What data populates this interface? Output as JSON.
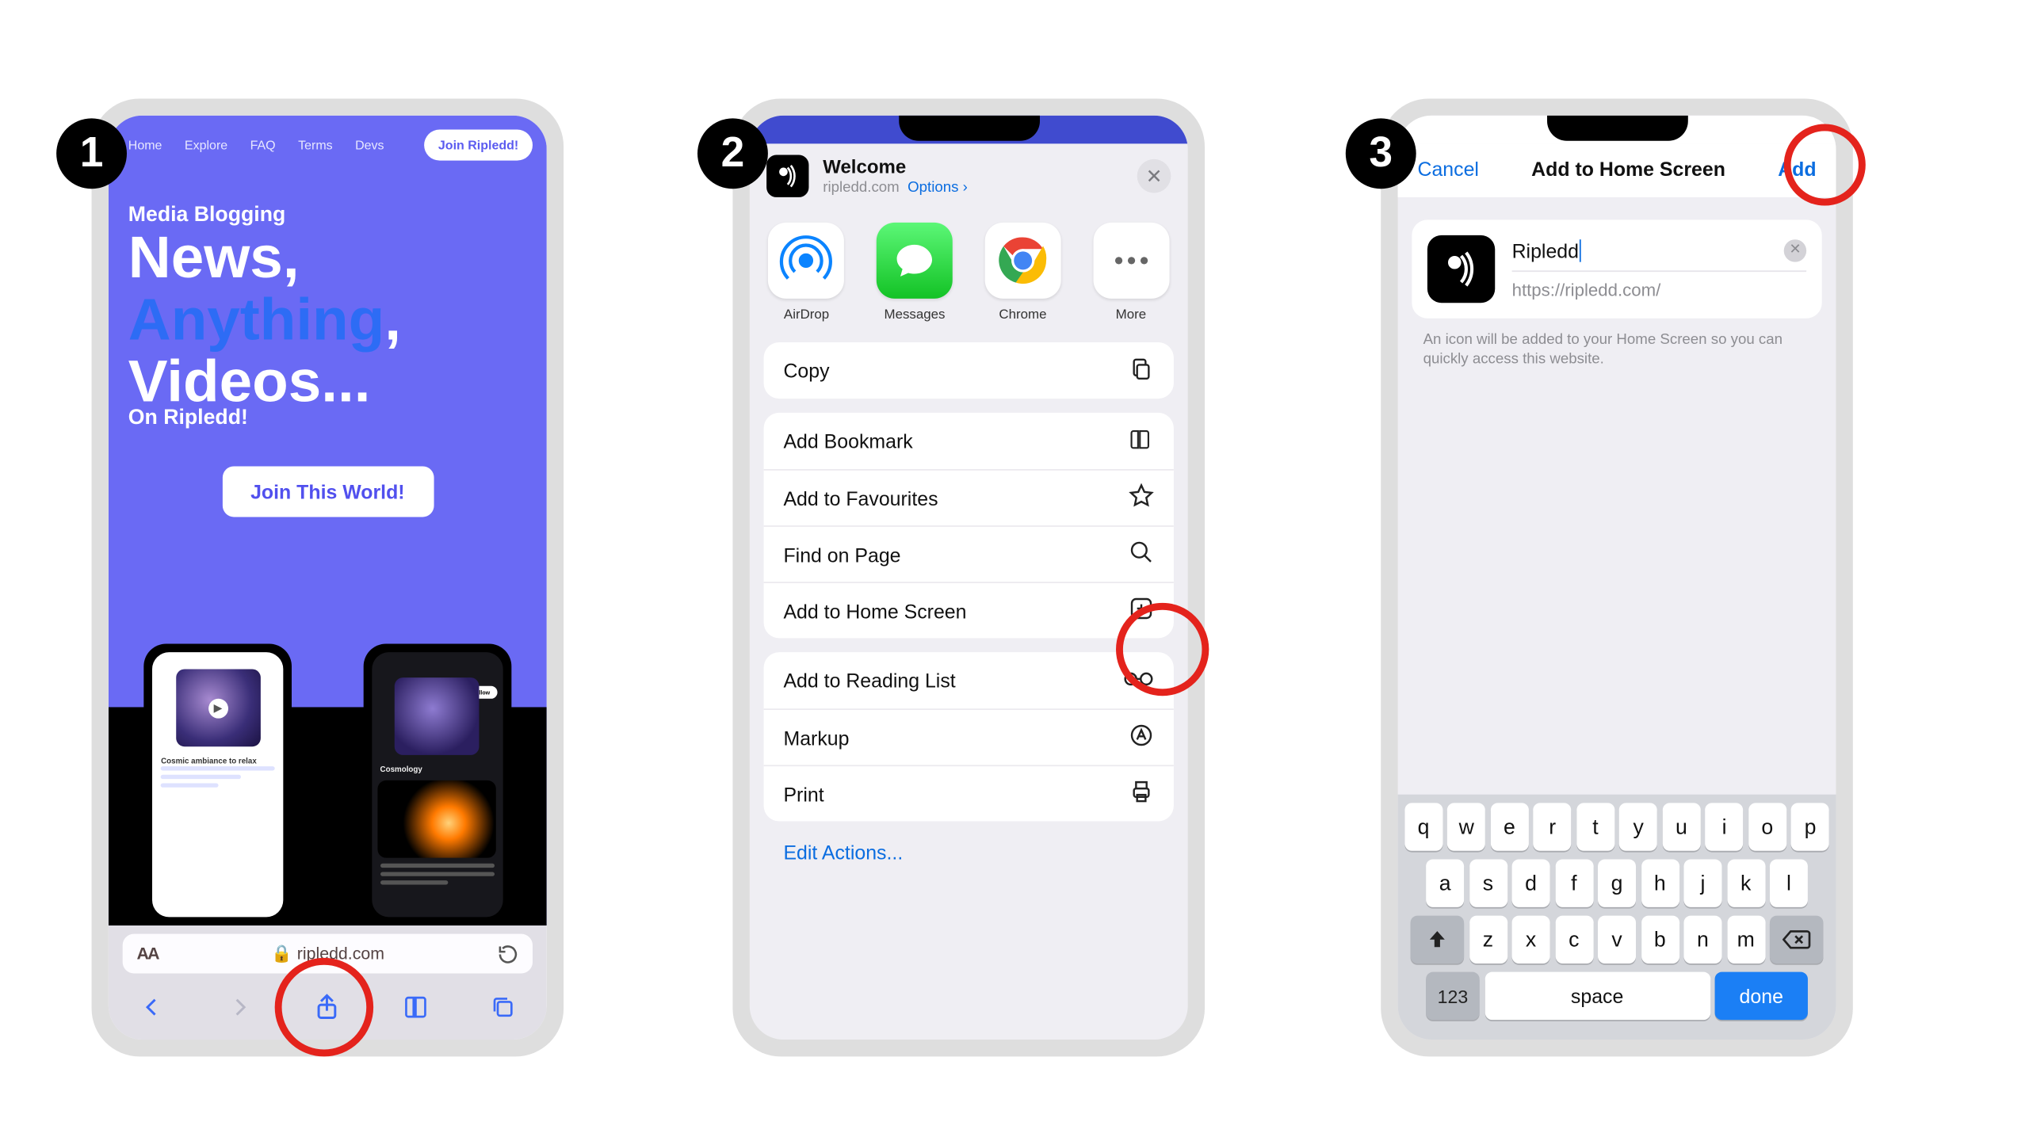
{
  "badges": [
    "1",
    "2",
    "3"
  ],
  "step1": {
    "nav": {
      "home": "Home",
      "explore": "Explore",
      "faq": "FAQ",
      "terms": "Terms",
      "devs": "Devs",
      "join": "Join Ripledd!"
    },
    "hero": {
      "tag": "Media Blogging",
      "l1": "News,",
      "l2": "Anything",
      "comma": ",",
      "l3": "Videos...",
      "sub": "On Ripledd!",
      "cta": "Join This World!"
    },
    "url": {
      "aa": "AA",
      "lock": "🔒",
      "domain": "ripledd.com"
    }
  },
  "step2": {
    "title": "Welcome",
    "site": "ripledd.com",
    "options": "Options",
    "chev": "›",
    "apps": [
      {
        "label": "AirDrop"
      },
      {
        "label": "Messages"
      },
      {
        "label": "Chrome"
      },
      {
        "label": "More"
      }
    ],
    "rows": {
      "copy": "Copy",
      "bookmark": "Add Bookmark",
      "fav": "Add to Favourites",
      "find": "Find on Page",
      "home": "Add to Home Screen",
      "read": "Add to Reading List",
      "markup": "Markup",
      "print": "Print"
    },
    "edit": "Edit Actions..."
  },
  "step3": {
    "cancel": "Cancel",
    "title": "Add to Home Screen",
    "add": "Add",
    "name": "Ripledd",
    "url": "https://ripledd.com/",
    "note": "An icon will be added to your Home Screen so you can quickly access this website.",
    "kb": {
      "r1": [
        "q",
        "w",
        "e",
        "r",
        "t",
        "y",
        "u",
        "i",
        "o",
        "p"
      ],
      "r2": [
        "a",
        "s",
        "d",
        "f",
        "g",
        "h",
        "j",
        "k",
        "l"
      ],
      "r3": [
        "z",
        "x",
        "c",
        "v",
        "b",
        "n",
        "m"
      ],
      "num": "123",
      "space": "space",
      "done": "done"
    }
  }
}
